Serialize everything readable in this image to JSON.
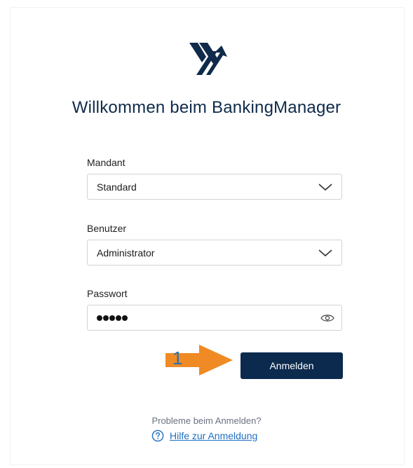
{
  "header": {
    "title": "Willkommen beim BankingManager",
    "logo_icon": "bankingmanager-logo-icon"
  },
  "form": {
    "mandant": {
      "label": "Mandant",
      "value": "Standard",
      "icon": "chevron-down-icon"
    },
    "benutzer": {
      "label": "Benutzer",
      "value": "Administrator",
      "icon": "chevron-down-icon"
    },
    "passwort": {
      "label": "Passwort",
      "masked_length": 5,
      "icon": "eye-icon"
    },
    "submit_label": "Anmelden"
  },
  "annotation": {
    "step_number": "1",
    "arrow_color": "#f08a24"
  },
  "help": {
    "question": "Probleme beim Anmelden?",
    "link_label": "Hilfe zur Anmeldung",
    "icon": "question-circle-icon"
  },
  "colors": {
    "brand_navy": "#0b2a4e",
    "link_blue": "#1f6fc5",
    "title_navy": "#0f2a4a"
  }
}
